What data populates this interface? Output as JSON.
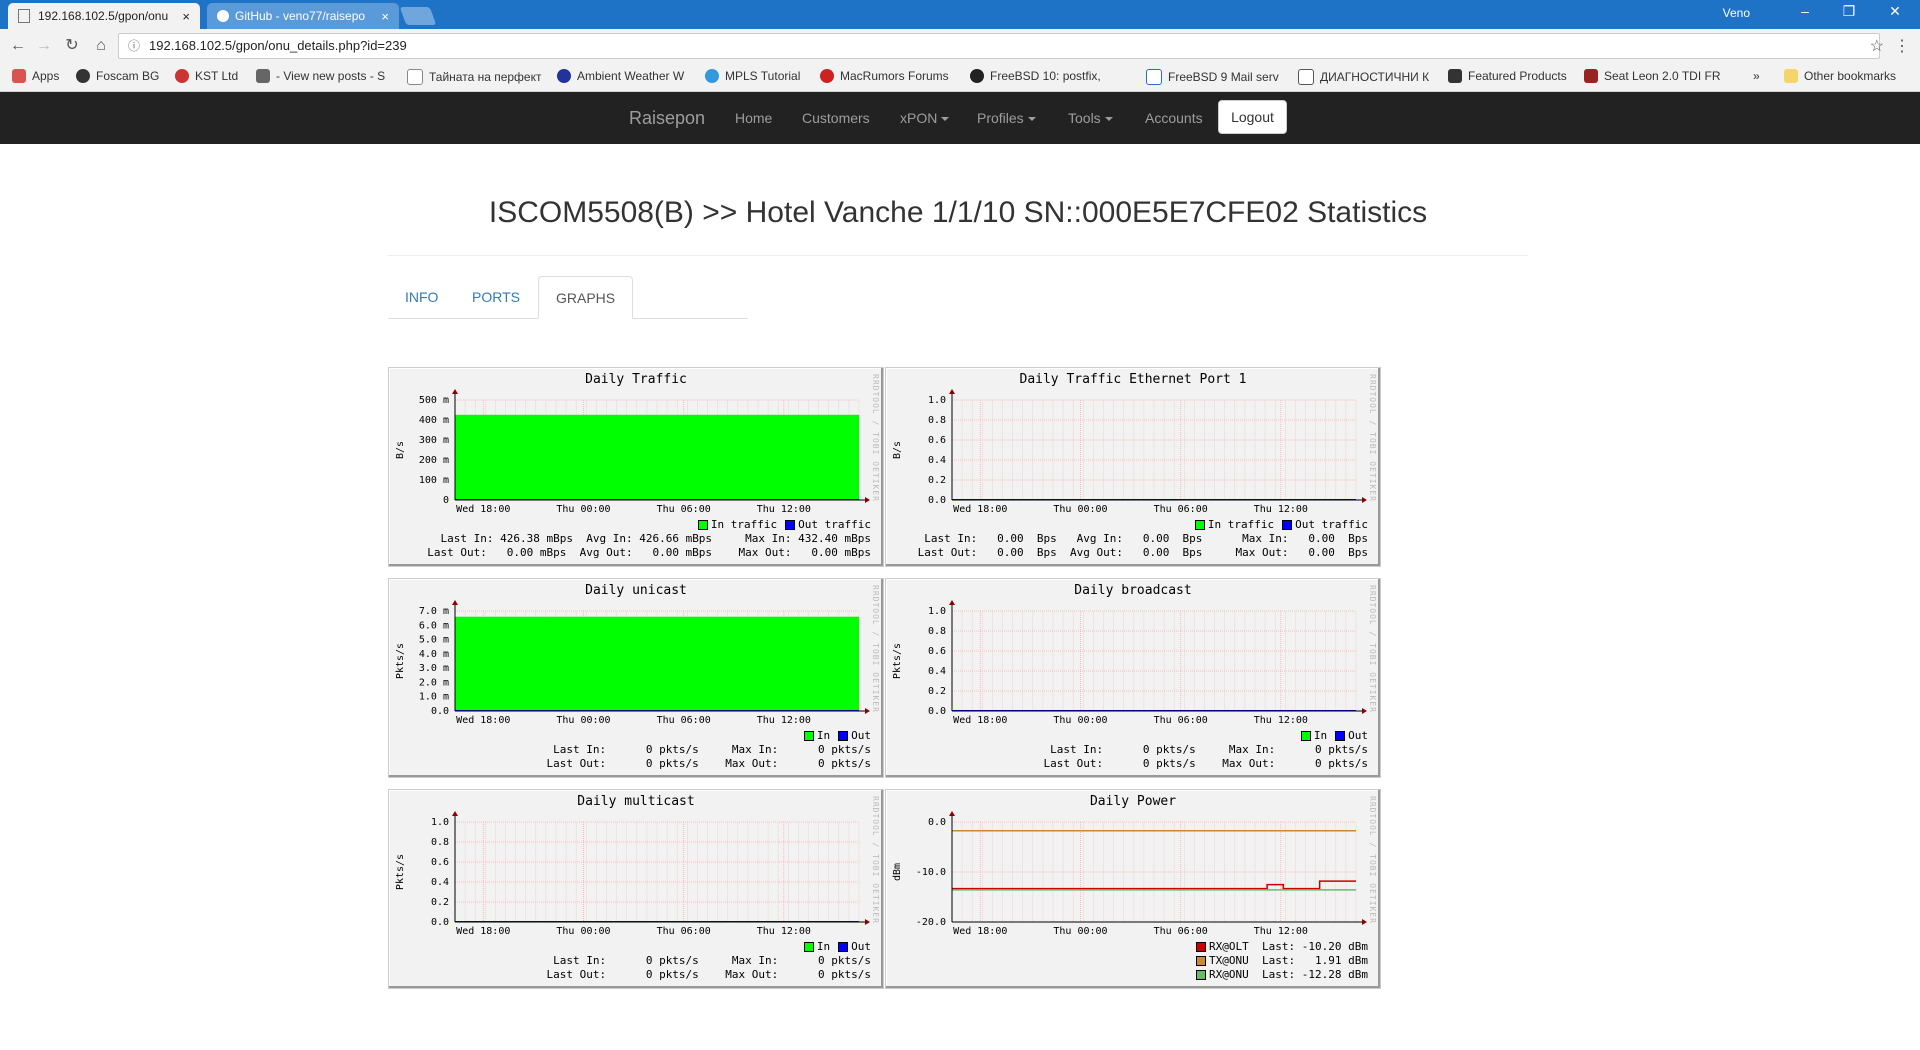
{
  "browser": {
    "tabs": [
      {
        "title": "192.168.102.5/gpon/onu",
        "close": "×"
      },
      {
        "title": "GitHub - veno77/raisepo",
        "close": "×"
      }
    ],
    "user": "Veno",
    "window_controls": [
      "–",
      "❐",
      "✕"
    ],
    "address": "192.168.102.5/gpon/onu_details.php?id=239",
    "bookmarks": [
      {
        "label": "Apps",
        "color": "#d9534f"
      },
      {
        "label": "Foscam BG",
        "color": "#333333"
      },
      {
        "label": "KST Ltd",
        "color": "#cc3333"
      },
      {
        "label": "- View new posts - S",
        "color": "#666666"
      },
      {
        "label": "Тайната на перфект",
        "color": "#999999"
      },
      {
        "label": "Ambient Weather W",
        "color": "#223399"
      },
      {
        "label": "MPLS Tutorial",
        "color": "#3399dd"
      },
      {
        "label": "MacRumors Forums",
        "color": "#cc2222"
      },
      {
        "label": "FreeBSD 10: postfix,",
        "color": "#222222"
      },
      {
        "label": "FreeBSD 9 Mail serv",
        "color": "#3366cc"
      },
      {
        "label": "ДИАГНОСТИЧНИ К",
        "color": "#555555"
      },
      {
        "label": "Featured Products",
        "color": "#333333"
      },
      {
        "label": "Seat Leon 2.0 TDI FR",
        "color": "#992222"
      }
    ],
    "more_bookmarks": "»",
    "other_bookmarks": "Other bookmarks"
  },
  "navbar": {
    "brand": "Raisepon",
    "links": [
      "Home",
      "Customers",
      "xPON",
      "Profiles",
      "Tools",
      "Accounts"
    ],
    "logout": "Logout"
  },
  "page": {
    "title": "ISCOM5508(B) >> Hotel Vanche 1/1/10 SN::000E5E7CFE02 Statistics",
    "tabs": [
      "INFO",
      "PORTS",
      "GRAPHS"
    ],
    "active_tab": "GRAPHS"
  },
  "watermark": "RRDTOOL / TOBI OETIKER",
  "colors": {
    "in": "#00ff00",
    "out": "#0000ff",
    "rx_olt": "#cc0000",
    "tx_onu": "#cc8833",
    "rx_onu": "#66bb66",
    "grid": "#ffaaaa"
  },
  "chart_data": [
    {
      "type": "area",
      "title": "Daily Traffic",
      "ylabel": "B/s",
      "xticks": [
        "Wed 18:00",
        "Thu 00:00",
        "Thu 06:00",
        "Thu 12:00"
      ],
      "yticks": [
        "0",
        "100 m",
        "200 m",
        "300 m",
        "400 m",
        "500 m"
      ],
      "ylim": [
        0,
        0.5
      ],
      "series": [
        {
          "name": "In traffic",
          "value": 0.426
        },
        {
          "name": "Out traffic",
          "value": 0
        }
      ],
      "stats": [
        "Last In: 426.38 mBps  Avg In: 426.66 mBps     Max In: 432.40 mBps",
        "Last Out:   0.00 mBps  Avg Out:   0.00 mBps    Max Out:   0.00 mBps"
      ]
    },
    {
      "type": "area",
      "title": "Daily Traffic Ethernet Port 1",
      "ylabel": "B/s",
      "xticks": [
        "Wed 18:00",
        "Thu 00:00",
        "Thu 06:00",
        "Thu 12:00"
      ],
      "yticks": [
        "0.0",
        "0.2",
        "0.4",
        "0.6",
        "0.8",
        "1.0"
      ],
      "ylim": [
        0,
        1
      ],
      "series": [
        {
          "name": "In traffic",
          "value": 0
        },
        {
          "name": "Out traffic",
          "value": 0
        }
      ],
      "stats": [
        "Last In:   0.00  Bps   Avg In:   0.00  Bps      Max In:   0.00  Bps",
        "Last Out:   0.00  Bps  Avg Out:   0.00  Bps     Max Out:   0.00  Bps"
      ]
    },
    {
      "type": "area",
      "title": "Daily unicast",
      "ylabel": "Pkts/s",
      "xticks": [
        "Wed 18:00",
        "Thu 00:00",
        "Thu 06:00",
        "Thu 12:00"
      ],
      "yticks": [
        "0.0",
        "1.0 m",
        "2.0 m",
        "3.0 m",
        "4.0 m",
        "5.0 m",
        "6.0 m",
        "7.0 m"
      ],
      "ylim": [
        0,
        0.007
      ],
      "series": [
        {
          "name": "In",
          "value": 0.0066
        },
        {
          "name": "Out",
          "value": 0
        }
      ],
      "stats": [
        "        Last In:      0 pkts/s     Max In:      0 pkts/s",
        "       Last Out:      0 pkts/s    Max Out:      0 pkts/s"
      ]
    },
    {
      "type": "area",
      "title": "Daily broadcast",
      "ylabel": "Pkts/s",
      "xticks": [
        "Wed 18:00",
        "Thu 00:00",
        "Thu 06:00",
        "Thu 12:00"
      ],
      "yticks": [
        "0.0",
        "0.2",
        "0.4",
        "0.6",
        "0.8",
        "1.0"
      ],
      "ylim": [
        0,
        1
      ],
      "series": [
        {
          "name": "In",
          "value": 0
        },
        {
          "name": "Out",
          "value": 0
        }
      ],
      "stats": [
        "        Last In:      0 pkts/s     Max In:      0 pkts/s",
        "       Last Out:      0 pkts/s    Max Out:      0 pkts/s"
      ]
    },
    {
      "type": "area",
      "title": "Daily multicast",
      "ylabel": "Pkts/s",
      "xticks": [
        "Wed 18:00",
        "Thu 00:00",
        "Thu 06:00",
        "Thu 12:00"
      ],
      "yticks": [
        "0.0",
        "0.2",
        "0.4",
        "0.6",
        "0.8",
        "1.0"
      ],
      "ylim": [
        0,
        1
      ],
      "series": [
        {
          "name": "In",
          "value": 0
        },
        {
          "name": "Out",
          "value": 0
        }
      ],
      "stats": [
        "        Last In:      0 pkts/s     Max In:      0 pkts/s",
        "       Last Out:      0 pkts/s    Max Out:      0 pkts/s"
      ]
    },
    {
      "type": "line",
      "title": "Daily Power",
      "ylabel": "dBm",
      "xticks": [
        "Wed 18:00",
        "Thu 00:00",
        "Thu 06:00",
        "Thu 12:00"
      ],
      "yticks": [
        "-20.0",
        "-10.0",
        "0.0"
      ],
      "ylim": [
        -20,
        4
      ],
      "series": [
        {
          "name": "RX@OLT",
          "value": -10.2,
          "base": -12.0,
          "last": "Last: -10.20 dBm"
        },
        {
          "name": "TX@ONU",
          "value": 1.91,
          "base": 1.91,
          "last": "Last:   1.91 dBm"
        },
        {
          "name": "RX@ONU",
          "value": -12.28,
          "base": -12.28,
          "last": "Last: -12.28 dBm"
        }
      ]
    }
  ]
}
